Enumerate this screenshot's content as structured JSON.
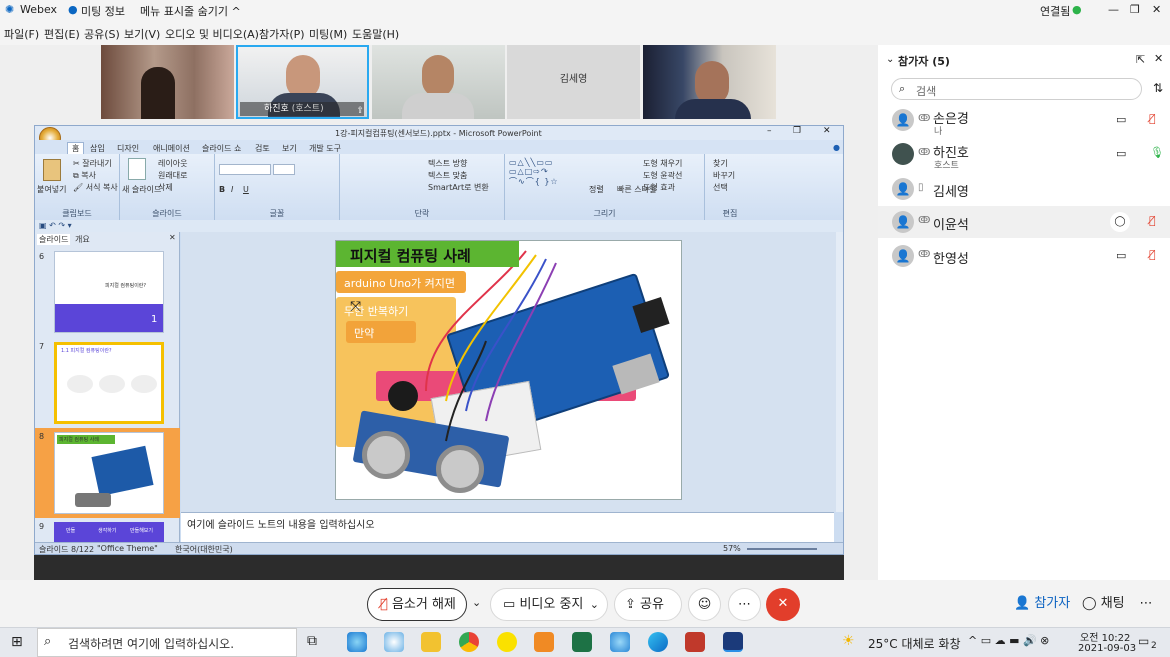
{
  "titlebar": {
    "app_name": "Webex",
    "meeting_info": "미팅 정보",
    "hide_menu": "메뉴 표시줄 숨기기",
    "connection": "연결됨"
  },
  "menu": [
    "파일(F)",
    "편집(E)",
    "공유(S)",
    "보기(V)",
    "오디오 및 비디오(A)",
    "참가자(P)",
    "미팅(M)",
    "도움말(H)"
  ],
  "video_strip": {
    "active_name": "하진호",
    "active_role": "(호스트)",
    "placeholder_name": "김세영"
  },
  "ppt": {
    "window_title": "1강-피지컬컴퓨팅(센서보드).pptx - Microsoft PowerPoint",
    "tabs": [
      "홈",
      "삽입",
      "디자인",
      "애니메이션",
      "슬라이드 쇼",
      "검토",
      "보기",
      "개발 도구"
    ],
    "ribbon": {
      "clipboard_label": "클립보드",
      "paste": "붙여넣기",
      "cut": "잘라내기",
      "copy": "복사",
      "format_painter": "서식 복사",
      "slides_label": "슬라이드",
      "new_slide": "새 슬라이드",
      "layout": "레이아웃",
      "reset": "원래대로",
      "delete": "삭제",
      "font_label": "글꼴",
      "paragraph_label": "단락",
      "text_direction": "텍스트 방향",
      "align_text": "텍스트 맞춤",
      "smartart": "SmartArt로 변환",
      "drawing_label": "그리기",
      "arrange": "정렬",
      "quick_styles": "빠른 스타일",
      "shape_fill": "도형 채우기",
      "shape_outline": "도형 윤곽선",
      "shape_effects": "도형 효과",
      "editing_label": "편집",
      "find": "찾기",
      "replace": "바꾸기",
      "select": "선택"
    },
    "panel_tabs": [
      "슬라이드",
      "개요"
    ],
    "thumbs": [
      {
        "num": "6",
        "title": "피지컬 컴퓨팅이란?",
        "page": "1"
      },
      {
        "num": "7",
        "title": "1.1 피지컬 컴퓨팅이란?"
      },
      {
        "num": "8",
        "title": "피지컬 컴퓨팅 사례"
      },
      {
        "num": "9",
        "buttons": [
          "만들",
          "생각하기",
          "만들해보기"
        ]
      }
    ],
    "slide": {
      "title": "피지컬 컴퓨팅 사례",
      "blocks": [
        "arduino Uno가 켜지면",
        "무한 반복하기",
        "만약"
      ]
    },
    "notes_placeholder": "여기에 슬라이드 노트의 내용을 입력하십시오",
    "status": {
      "slide": "슬라이드 8/122",
      "theme": "\"Office Theme\"",
      "lang": "한국어(대한민국)",
      "zoom": "57%"
    }
  },
  "sidebar": {
    "title": "참가자 (5)",
    "search_placeholder": "검색",
    "participants": [
      {
        "name": "손은경",
        "sub": "나",
        "avatar": "person",
        "media": "video-icon",
        "mic": "muted"
      },
      {
        "name": "하진호",
        "sub": "호스트",
        "avatar": "photo",
        "media": "video-icon",
        "mic": "active"
      },
      {
        "name": "김세영",
        "sub": "",
        "avatar": "person",
        "media": "phone-icon",
        "mic": "none"
      },
      {
        "name": "이윤석",
        "sub": "",
        "avatar": "person",
        "media": "chat-icon",
        "mic": "muted"
      },
      {
        "name": "한영성",
        "sub": "",
        "avatar": "person",
        "media": "video-icon",
        "mic": "muted"
      }
    ]
  },
  "controls": {
    "unmute": "음소거 해제",
    "stop_video": "비디오 중지",
    "share": "공유",
    "participants": "참가자",
    "chat": "채팅"
  },
  "taskbar": {
    "search_placeholder": "검색하려면 여기에 입력하십시오.",
    "weather": "25°C 대체로 화창",
    "time": "오전 10:22",
    "date": "2021-09-03",
    "notifications": "2"
  },
  "colors": {
    "accent": "#0b7bd9",
    "end_red": "#e23e2b",
    "ribbon": "#cdddf1",
    "ppt_blue": "#1f3f75",
    "green_title": "#5cb531"
  }
}
